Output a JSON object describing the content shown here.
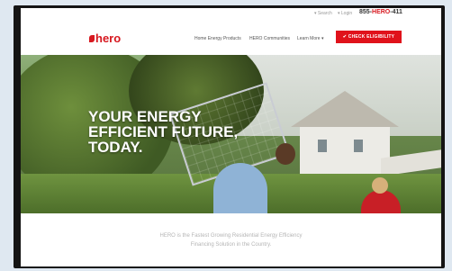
{
  "utility_bar": {
    "link1": "▾ Search",
    "link2": "▾ Login",
    "phone_prefix": "855-",
    "phone_accent": "HERO",
    "phone_suffix": "-411"
  },
  "header": {
    "logo_text": "hero",
    "nav": [
      "Home Energy Products",
      "HERO Communities",
      "Learn More ▾"
    ],
    "cta_label": "✔ CHECK ELIGIBILITY"
  },
  "hero": {
    "headline_lines": [
      "YOUR ENERGY",
      "EFFICIENT FUTURE,",
      "TODAY."
    ]
  },
  "tagline": {
    "line1": "HERO is the Fastest Growing Residential Energy Efficiency",
    "line2": "Financing Solution in the Country."
  },
  "colors": {
    "brand_red": "#d71920",
    "cta_red": "#e0121b"
  }
}
